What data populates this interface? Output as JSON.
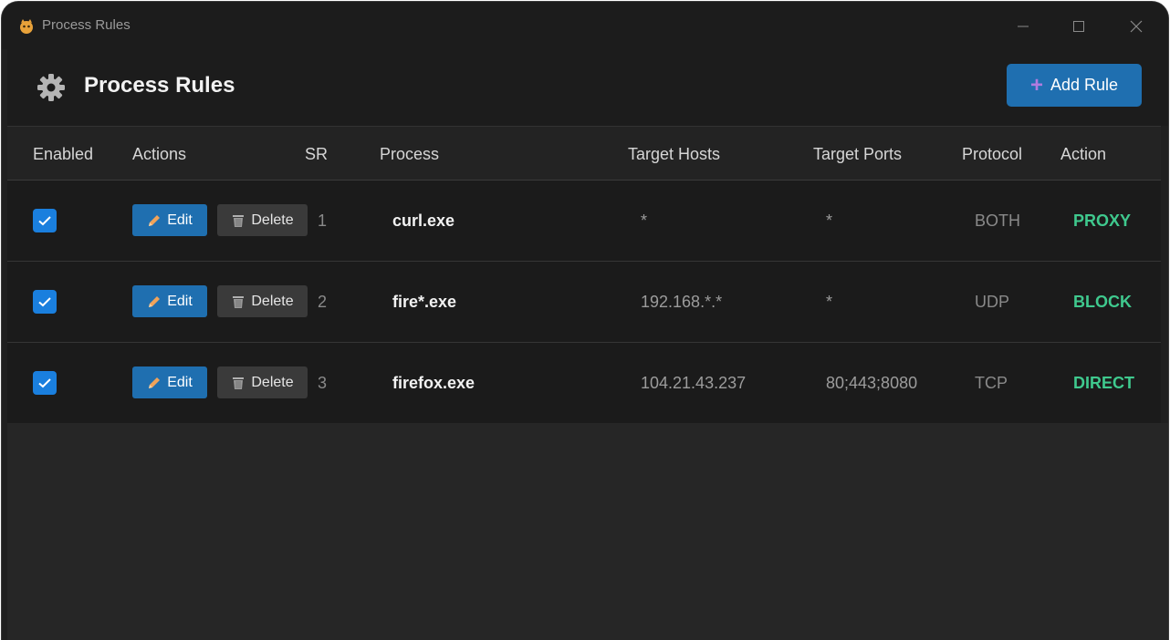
{
  "window": {
    "title": "Process Rules"
  },
  "header": {
    "title": "Process Rules",
    "add_button_label": "Add Rule"
  },
  "table": {
    "columns": [
      "Enabled",
      "Actions",
      "SR",
      "Process",
      "Target Hosts",
      "Target Ports",
      "Protocol",
      "Action"
    ],
    "edit_label": "Edit",
    "delete_label": "Delete",
    "rows": [
      {
        "enabled": true,
        "sr": "1",
        "process": "curl.exe",
        "hosts": "*",
        "ports": "*",
        "protocol": "BOTH",
        "action": "PROXY"
      },
      {
        "enabled": true,
        "sr": "2",
        "process": "fire*.exe",
        "hosts": "192.168.*.*",
        "ports": "*",
        "protocol": "UDP",
        "action": "BLOCK"
      },
      {
        "enabled": true,
        "sr": "3",
        "process": "firefox.exe",
        "hosts": "104.21.43.237",
        "ports": "80;443;8080",
        "protocol": "TCP",
        "action": "DIRECT"
      }
    ]
  },
  "colors": {
    "accent": "#1f6fb0",
    "checkbox": "#1a7fde",
    "action_text": "#3fc98e",
    "background": "#202020"
  },
  "icons": {
    "app": "app-logo-icon",
    "header": "gear-icon",
    "add": "plus-icon",
    "edit": "pencil-icon",
    "delete": "trash-icon",
    "checkbox": "checkmark-icon"
  }
}
